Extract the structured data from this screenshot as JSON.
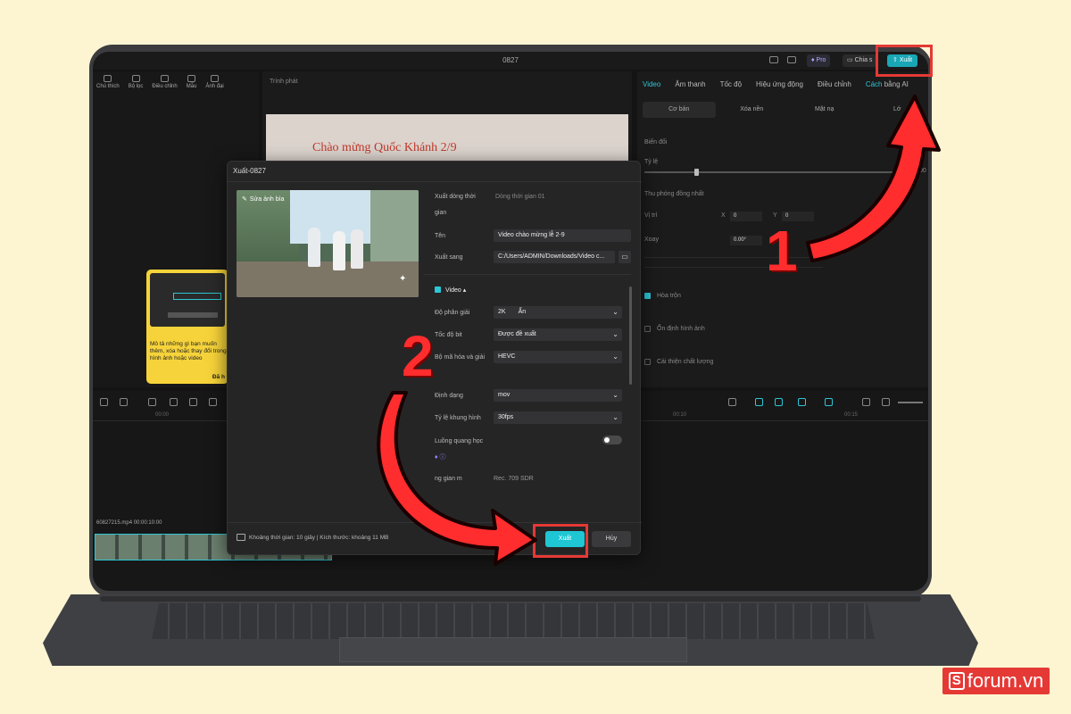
{
  "window": {
    "title": "0827",
    "pro_badge": "Pro",
    "share_label": "Chia s",
    "export_label": "Xuất"
  },
  "media_tabs": [
    "Chú thích",
    "Bộ lọc",
    "Điều chỉnh",
    "Mẫu",
    "Ảnh đại"
  ],
  "player": {
    "title": "Trình phát",
    "caption": "Chào mừng Quốc Khánh 2/9"
  },
  "inspector": {
    "tabs": [
      "Video",
      "Âm thanh",
      "Tốc độ",
      "Hiệu ứng động",
      "Điều chỉnh",
      "Cách",
      "bằng AI"
    ],
    "sub_tabs": [
      "Cơ bản",
      "Xóa nền",
      "Mặt nạ",
      "Lớ"
    ],
    "transform_label": "Biến đổi",
    "scale_label": "Tỷ lệ",
    "scale_value": "00",
    "uniform_label": "Thu phóng đồng nhất",
    "position_label": "Vị trí",
    "pos_x_label": "X",
    "pos_x": "0",
    "pos_y_label": "Y",
    "pos_y": "0",
    "rotate_label": "Xoay",
    "rotate_value": "0.00°",
    "blend_label": "Hòa trộn",
    "stabilize_label": "Ổn định hình ảnh",
    "enhance_label": "Cải thiện chất lượng"
  },
  "timeline": {
    "ruler": [
      "00:00",
      "00:10",
      "00:15"
    ],
    "clip_name": "60827215.mp4",
    "clip_time": "00:00:10:00"
  },
  "tooltip": {
    "text": "Mô tả những gì bạn muốn thêm, xóa hoặc thay đổi trong hình ảnh hoặc video",
    "done": "Đã h"
  },
  "dialog": {
    "title": "Xuất-0827",
    "edit_cover": "Sửa ảnh bìa",
    "timeline_label_1": "Xuất dòng thời",
    "timeline_label_2": "gian",
    "timeline_value": "Dòng thời gian 01",
    "name_label": "Tên",
    "name_value": "Video chào mừng lễ 2-9",
    "export_to_label": "Xuất sang",
    "export_to_value": "C:/Users/ADMIN/Downloads/Video c...",
    "video_section": "Video",
    "resolution_label": "Độ phân giải",
    "resolution_value": "2K",
    "resolution_badge": "Ẩn",
    "bitrate_label": "Tốc độ bit",
    "bitrate_value": "Được đề xuất",
    "codec_label": "Bộ mã hóa và giải",
    "codec_value": "HEVC",
    "format_label": "Định dạng",
    "format_value": "mov",
    "framerate_label": "Tỷ lệ khung hình",
    "framerate_value": "30fps",
    "optical_label": "Luồng quang học",
    "colorspace_label": "ng gian m",
    "colorspace_value": "Rec. 709 SDR",
    "footer_text": "Khoảng thời gian: 10 giây | Kích thước: khoảng 11 MB",
    "export_button": "Xuất",
    "cancel_button": "Hủy"
  },
  "annotations": {
    "step1": "1",
    "step2": "2",
    "color": "#ff2d2d"
  },
  "watermark": {
    "letter": "S",
    "text": "forum.vn"
  },
  "colors": {
    "accent": "#1fc6d4",
    "background": "#fdf5d2",
    "highlight": "#e53935"
  }
}
